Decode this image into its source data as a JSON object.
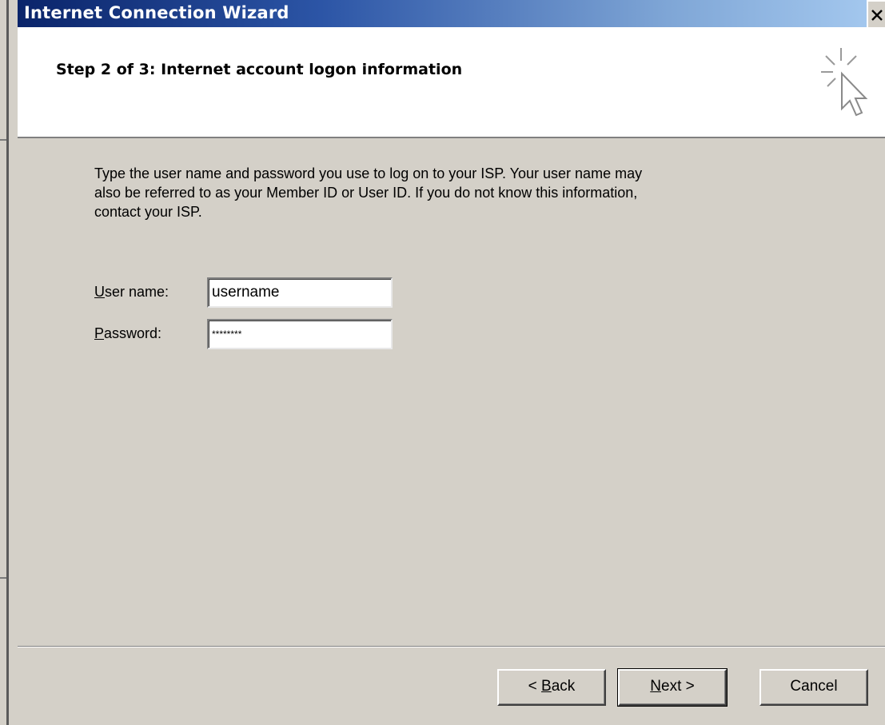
{
  "window": {
    "title": "Internet Connection Wizard",
    "close_glyph": "X"
  },
  "header": {
    "step_title": "Step 2 of 3: Internet account logon information",
    "icon": "wizard-cursor-sparkle-icon"
  },
  "content": {
    "intro_line1": "Type the user name and password you use to log on to your ISP. Your user name may",
    "intro_line2": "also be referred to as your Member ID or User ID. If you do not know this information,",
    "intro_line3": "contact your ISP.",
    "username": {
      "label_accel": "U",
      "label_rest": "ser name:",
      "value": "username"
    },
    "password": {
      "label_accel": "P",
      "label_rest": "assword:",
      "value": "********"
    }
  },
  "footer": {
    "back": {
      "prefix": "< ",
      "accel": "B",
      "rest": "ack"
    },
    "next": {
      "accel": "N",
      "rest": "ext >"
    },
    "cancel": "Cancel"
  },
  "colors": {
    "dialog_face": "#d4d0c8",
    "titlebar_start": "#0a246a",
    "titlebar_end": "#a6caf0",
    "header_bg": "#ffffff"
  }
}
